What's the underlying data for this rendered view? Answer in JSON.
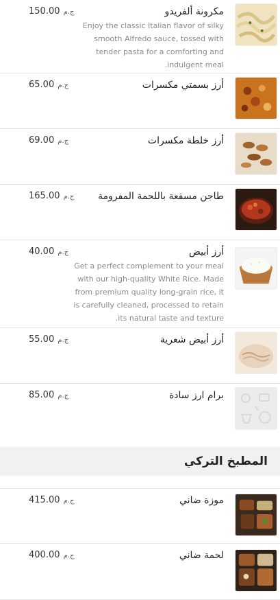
{
  "currency": "ج.م",
  "items": [
    {
      "name": "مكرونة ألفريدو",
      "price": "150.00",
      "desc": "Enjoy the classic Italian flavor of silky smooth Alfredo sauce, tossed with tender pasta for a comforting and indulgent meal.",
      "image_icon": "pasta-photo"
    },
    {
      "name": "أرز بسمتي مكسرات",
      "price": "65.00",
      "desc": "",
      "image_icon": "basmati-rice-photo"
    },
    {
      "name": "أرز خلطة مكسرات",
      "price": "69.00",
      "desc": "",
      "image_icon": "nuts-rice-photo"
    },
    {
      "name": "طاجن مسقعة باللحمة المفرومة",
      "price": "165.00",
      "desc": "",
      "image_icon": "moussaka-tagine-photo"
    },
    {
      "name": "أرز أبيض",
      "price": "40.00",
      "desc": "Get a perfect complement to your meal with our high-quality White Rice. Made from premium quality long-grain rice, it is carefully cleaned, processed to retain its natural taste and texture.",
      "image_icon": "white-rice-photo"
    },
    {
      "name": "أرز أبيض شعرية",
      "price": "55.00",
      "desc": "",
      "image_icon": "vermicelli-rice-photo"
    },
    {
      "name": "برام ارز سادة",
      "price": "85.00",
      "desc": "",
      "image_icon": "placeholder-food-icon"
    }
  ],
  "section": {
    "title": "المطبخ التركي"
  },
  "section_items": [
    {
      "name": "موزة ضاني",
      "price": "415.00",
      "desc": "",
      "image_icon": "lamb-shank-photo"
    },
    {
      "name": "لحمة ضاني",
      "price": "400.00",
      "desc": "",
      "image_icon": "lamb-meat-photo"
    }
  ]
}
